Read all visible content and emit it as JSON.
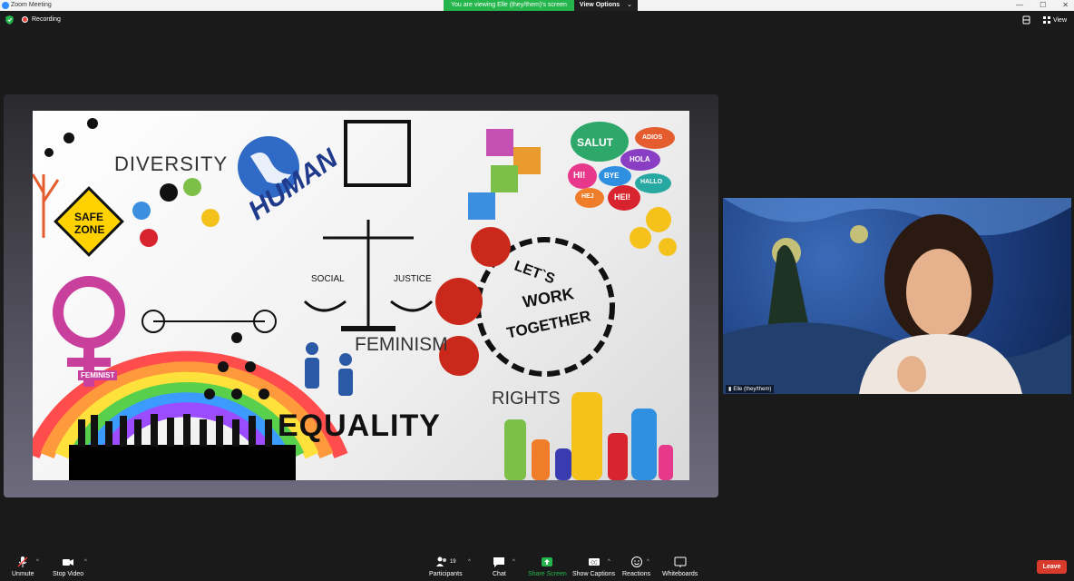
{
  "window": {
    "title": "Zoom Meeting",
    "minimize": "—",
    "maximize": "☐",
    "close": "✕"
  },
  "banner": {
    "message": "You are viewing Elle (they/them)'s screen",
    "view_options": "View Options",
    "caret": "⌄"
  },
  "topbar": {
    "recording": "Recording",
    "view": "View"
  },
  "slide": {
    "words": {
      "diversity": "DIVERSITY",
      "human": "HUMAN",
      "safe_zone_1": "SAFE",
      "safe_zone_2": "ZONE",
      "social": "SOCIAL",
      "justice": "JUSTICE",
      "feminism": "FEMINISM",
      "feminist": "FEMINIST",
      "lets": "LET`S",
      "work": "WORK",
      "together": "TOGETHER",
      "rights": "RIGHTS",
      "equality": "EQUALITY",
      "salut": "SALUT",
      "adios": "ADIOS",
      "hola": "HOLA",
      "hi": "HI!",
      "bye": "BYE",
      "hallo": "HALLO",
      "hej": "HEJ",
      "hei": "HEI!"
    }
  },
  "participant": {
    "name": "Elle (they/them)"
  },
  "toolbar": {
    "unmute": "Unmute",
    "stop_video": "Stop Video",
    "participants": "Participants",
    "participants_count": "19",
    "chat": "Chat",
    "share_screen": "Share Screen",
    "show_captions": "Show Captions",
    "reactions": "Reactions",
    "whiteboards": "Whiteboards",
    "leave": "Leave"
  },
  "colors": {
    "accent_green": "#24b54c",
    "leave_red": "#d83b2b",
    "zoom_blue": "#2d8cff"
  }
}
